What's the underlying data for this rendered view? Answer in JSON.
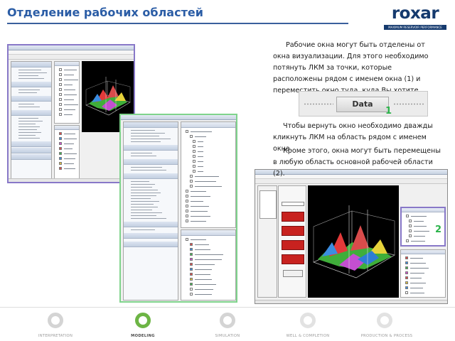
{
  "header": {
    "title": "Отделение рабочих областей",
    "logo_text": "roxar",
    "logo_tagline": "MAXIMUM RESERVOIR PERFORMANCE"
  },
  "paragraphs": {
    "p1": "Рабочие окна могут быть отделены от окна визуализации. Для этого необходимо потянуть ЛКМ за точки, которые расположены рядом с именем окна (1) и переместить окно туда, куда Вы хотите.",
    "p2": "Чтобы вернуть окно необходимо дважды кликнуть ЛКМ на область рядом с именем окна.",
    "p3": "Кроме этого, окна могут быть перемещены в любую область основной рабочей области (2)."
  },
  "data_pane": {
    "tab_label": "Data"
  },
  "callouts": {
    "one": "1",
    "two": "2"
  },
  "footer": {
    "nav": [
      "INTERPRETATION",
      "MODELING",
      "SIMULATION",
      "WELL & COMPLETION",
      "PRODUCTION & PROCESS"
    ],
    "active": "MODELING"
  },
  "colors": {
    "title_blue": "#2b5da6",
    "brand_navy": "#153a6e",
    "callout_green": "#2bb34a",
    "frame_purple": "#8878c8",
    "frame_green": "#7fd38c"
  }
}
